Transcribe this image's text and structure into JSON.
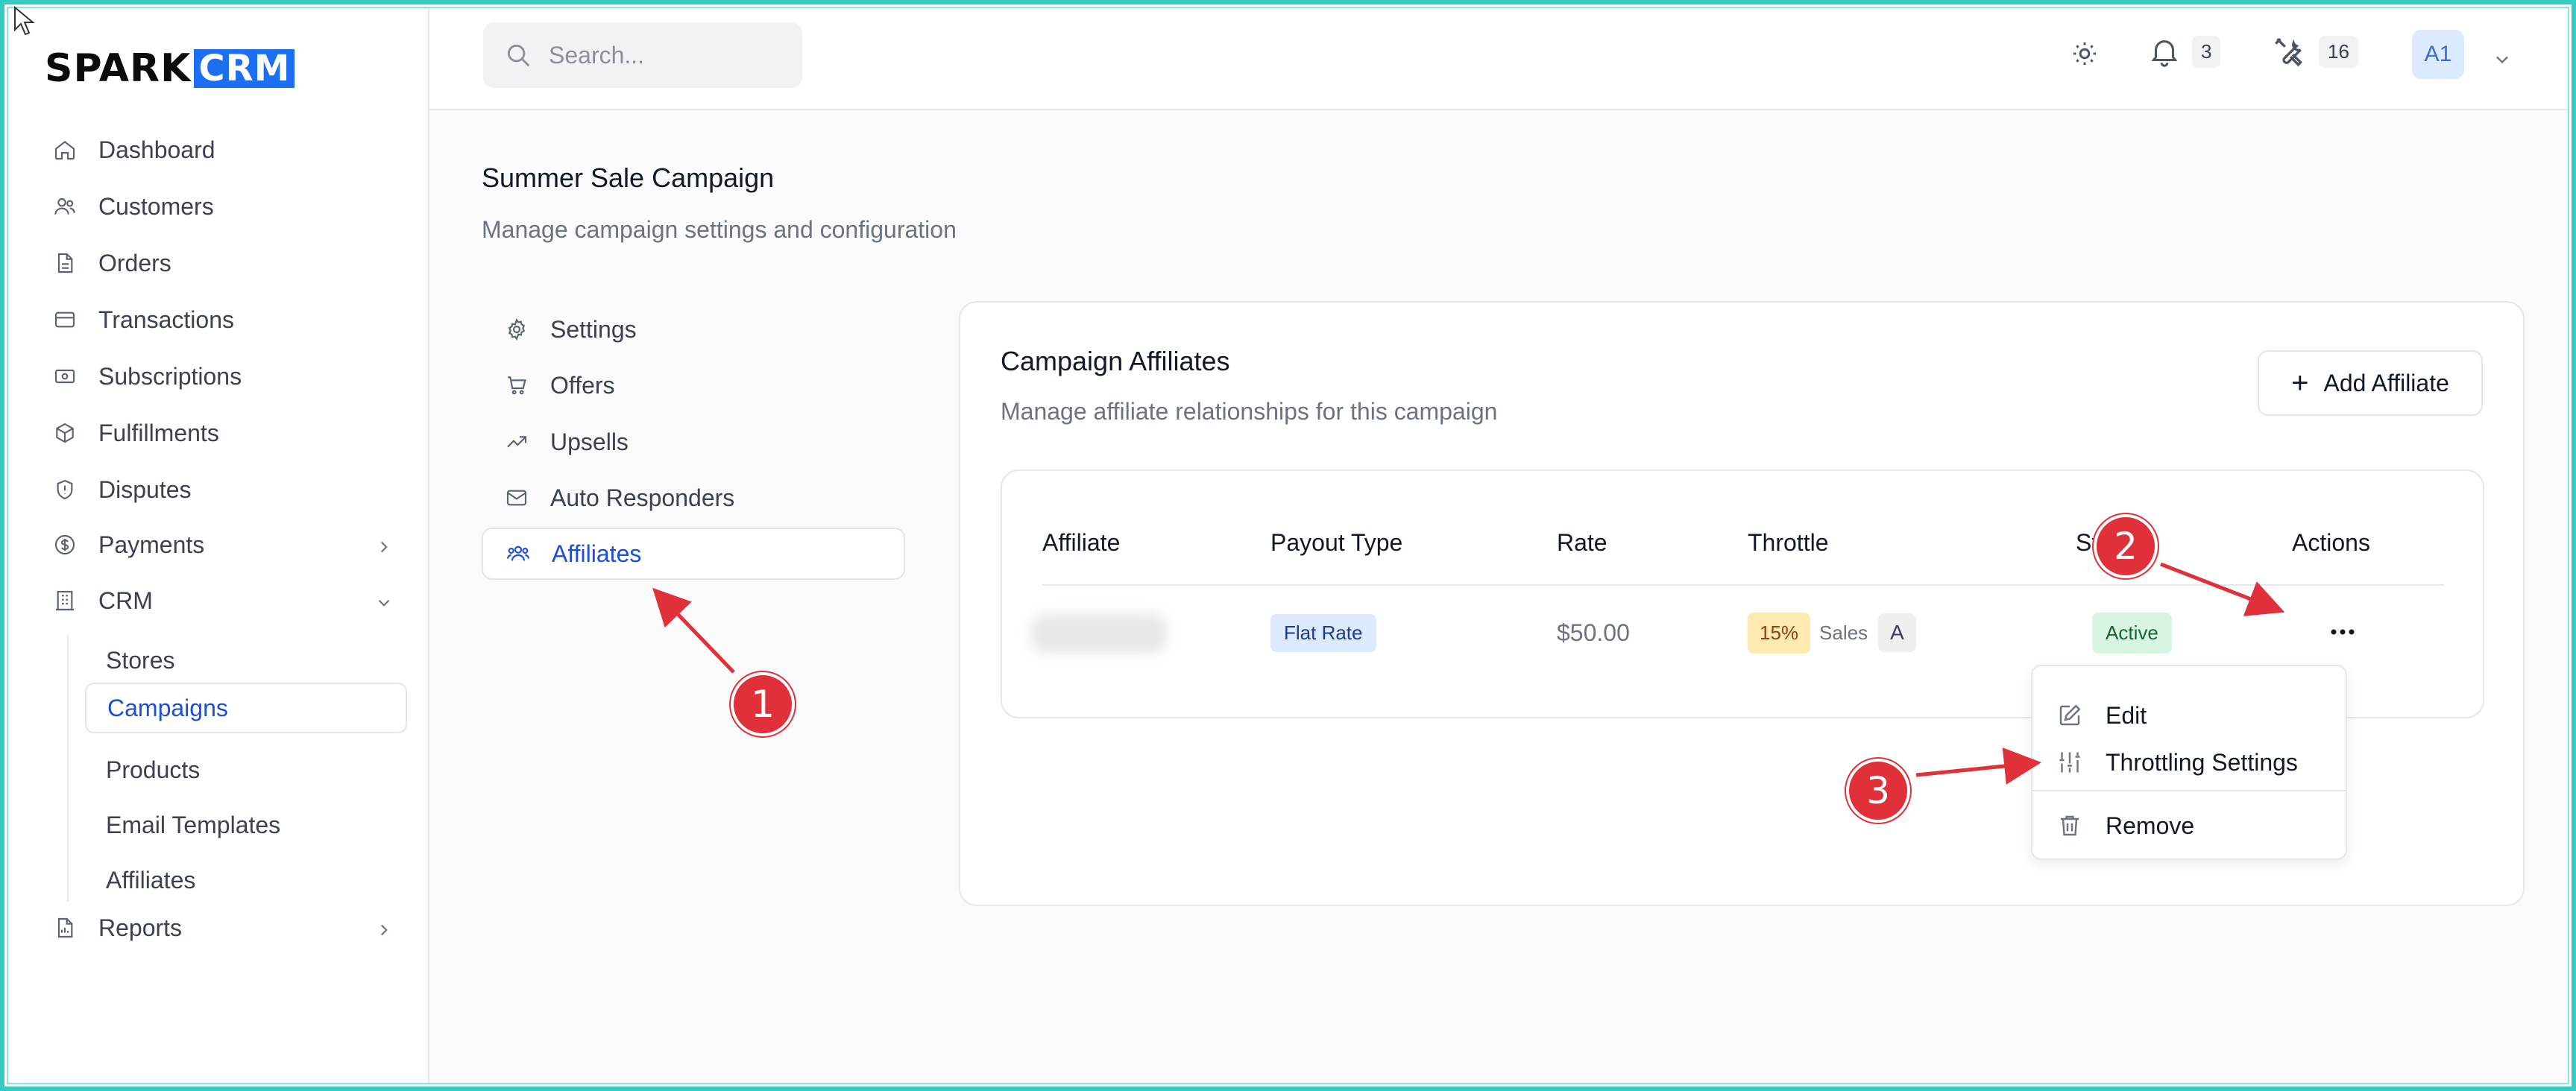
{
  "brand": {
    "part1": "SPARK",
    "part2": "CRM",
    "accent": "#1d6ff2"
  },
  "sidebar": {
    "items": [
      {
        "label": "Dashboard",
        "icon": "home-icon"
      },
      {
        "label": "Customers",
        "icon": "users-icon"
      },
      {
        "label": "Orders",
        "icon": "document-icon"
      },
      {
        "label": "Transactions",
        "icon": "credit-card-icon"
      },
      {
        "label": "Subscriptions",
        "icon": "banknote-icon"
      },
      {
        "label": "Fulfillments",
        "icon": "box-icon"
      },
      {
        "label": "Disputes",
        "icon": "shield-icon"
      },
      {
        "label": "Payments",
        "icon": "dollar-circle-icon"
      },
      {
        "label": "CRM",
        "icon": "building-icon"
      },
      {
        "label": "Reports",
        "icon": "report-icon"
      }
    ],
    "crm_sub": [
      "Stores",
      "Campaigns",
      "Products",
      "Email Templates",
      "Affiliates"
    ],
    "active_sub": "Campaigns"
  },
  "topbar": {
    "search_placeholder": "Search...",
    "notifications_count": "3",
    "tools_count": "16",
    "avatar_initials": "A1"
  },
  "page": {
    "title": "Summer Sale Campaign",
    "subtitle": "Manage campaign settings and configuration"
  },
  "tabs": [
    {
      "label": "Settings",
      "icon": "gear-icon"
    },
    {
      "label": "Offers",
      "icon": "cart-icon"
    },
    {
      "label": "Upsells",
      "icon": "trend-up-icon"
    },
    {
      "label": "Auto Responders",
      "icon": "mail-icon"
    },
    {
      "label": "Affiliates",
      "icon": "users-icon",
      "active": true
    }
  ],
  "card": {
    "title": "Campaign Affiliates",
    "subtitle": "Manage affiliate relationships for this campaign",
    "add_button": "Add Affiliate"
  },
  "table": {
    "headers": [
      "Affiliate",
      "Payout Type",
      "Rate",
      "Throttle",
      "Status",
      "Actions"
    ],
    "row": {
      "affiliate": "",
      "payout_type": "Flat Rate",
      "rate": "$50.00",
      "throttle_pct": "15%",
      "throttle_label": "Sales",
      "throttle_letter": "A",
      "status": "Active"
    }
  },
  "menu": {
    "items": [
      {
        "label": "Edit",
        "icon": "pencil-icon"
      },
      {
        "label": "Throttling Settings",
        "icon": "sliders-icon"
      },
      {
        "label": "Remove",
        "icon": "trash-icon"
      }
    ]
  },
  "annotations": {
    "markers": [
      "1",
      "2",
      "3"
    ],
    "color": "#e0303a"
  },
  "colors": {
    "active_blue": "#1d4ed8",
    "frame_teal": "#34cbc2"
  }
}
